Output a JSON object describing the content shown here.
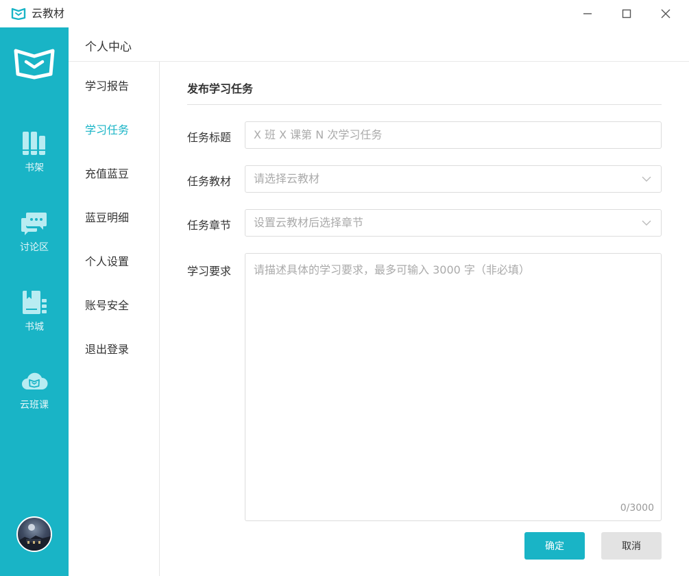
{
  "window": {
    "title": "云教材"
  },
  "rail": {
    "items": [
      {
        "label": "书架",
        "icon": "bookshelf-icon"
      },
      {
        "label": "讨论区",
        "icon": "chat-bubbles-icon"
      },
      {
        "label": "书城",
        "icon": "bookstore-icon"
      },
      {
        "label": "云班课",
        "icon": "cloud-class-icon"
      }
    ],
    "color": "#19b4c6"
  },
  "header": {
    "title": "个人中心"
  },
  "subnav": {
    "items": [
      {
        "label": "学习报告",
        "active": false
      },
      {
        "label": "学习任务",
        "active": true
      },
      {
        "label": "充值蓝豆",
        "active": false
      },
      {
        "label": "蓝豆明细",
        "active": false
      },
      {
        "label": "个人设置",
        "active": false
      },
      {
        "label": "账号安全",
        "active": false
      },
      {
        "label": "退出登录",
        "active": false
      }
    ]
  },
  "form": {
    "title": "发布学习任务",
    "fields": {
      "task_title": {
        "label": "任务标题",
        "placeholder": "X 班 X 课第 N 次学习任务",
        "value": ""
      },
      "material": {
        "label": "任务教材",
        "placeholder": "请选择云教材"
      },
      "chapter": {
        "label": "任务章节",
        "placeholder": "设置云教材后选择章节"
      },
      "requirements": {
        "label": "学习要求",
        "placeholder": "请描述具体的学习要求，最多可输入 3000 字（非必填）",
        "counter": "0/3000"
      }
    },
    "buttons": {
      "confirm": "确定",
      "cancel": "取消"
    }
  }
}
